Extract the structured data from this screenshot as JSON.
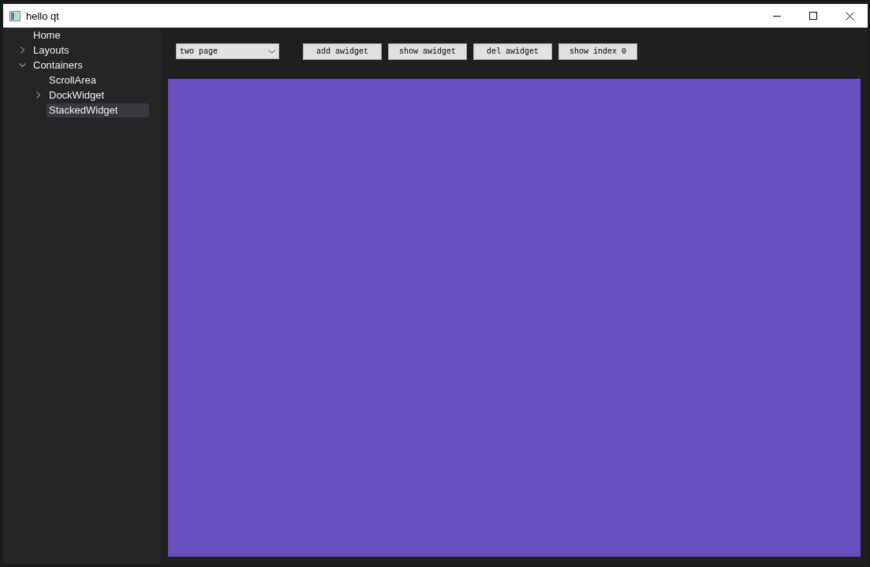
{
  "window": {
    "title": "hello qt"
  },
  "sidebar": {
    "tree": [
      {
        "label": "Home",
        "kind": "leaf",
        "selected": false
      },
      {
        "label": "Layouts",
        "kind": "branch",
        "expanded": false,
        "selected": false
      },
      {
        "label": "Containers",
        "kind": "branch",
        "expanded": true,
        "selected": false,
        "children": [
          {
            "label": "ScrollArea",
            "kind": "leaf",
            "selected": false
          },
          {
            "label": "DockWidget",
            "kind": "branch",
            "expanded": false,
            "selected": false
          },
          {
            "label": "StackedWidget",
            "kind": "leaf",
            "selected": true
          }
        ]
      }
    ]
  },
  "toolbar": {
    "page_select": {
      "value": "two page"
    },
    "buttons": [
      "add awidget",
      "show awidget",
      "del awidget",
      "show index 0"
    ]
  }
}
